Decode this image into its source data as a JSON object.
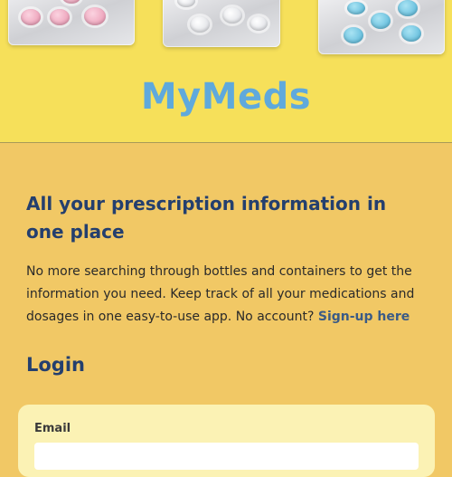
{
  "header": {
    "brand": "MyMeds"
  },
  "main": {
    "headline": "All your prescription information in one place",
    "intro": "No more searching through bottles and containers to get the information you need. Keep track of all your medications and dosages in one easy-to-use app. No account?",
    "signup_link": "Sign-up here",
    "login_heading": "Login"
  },
  "login_form": {
    "email_label": "Email",
    "email_value": "",
    "email_placeholder": ""
  }
}
